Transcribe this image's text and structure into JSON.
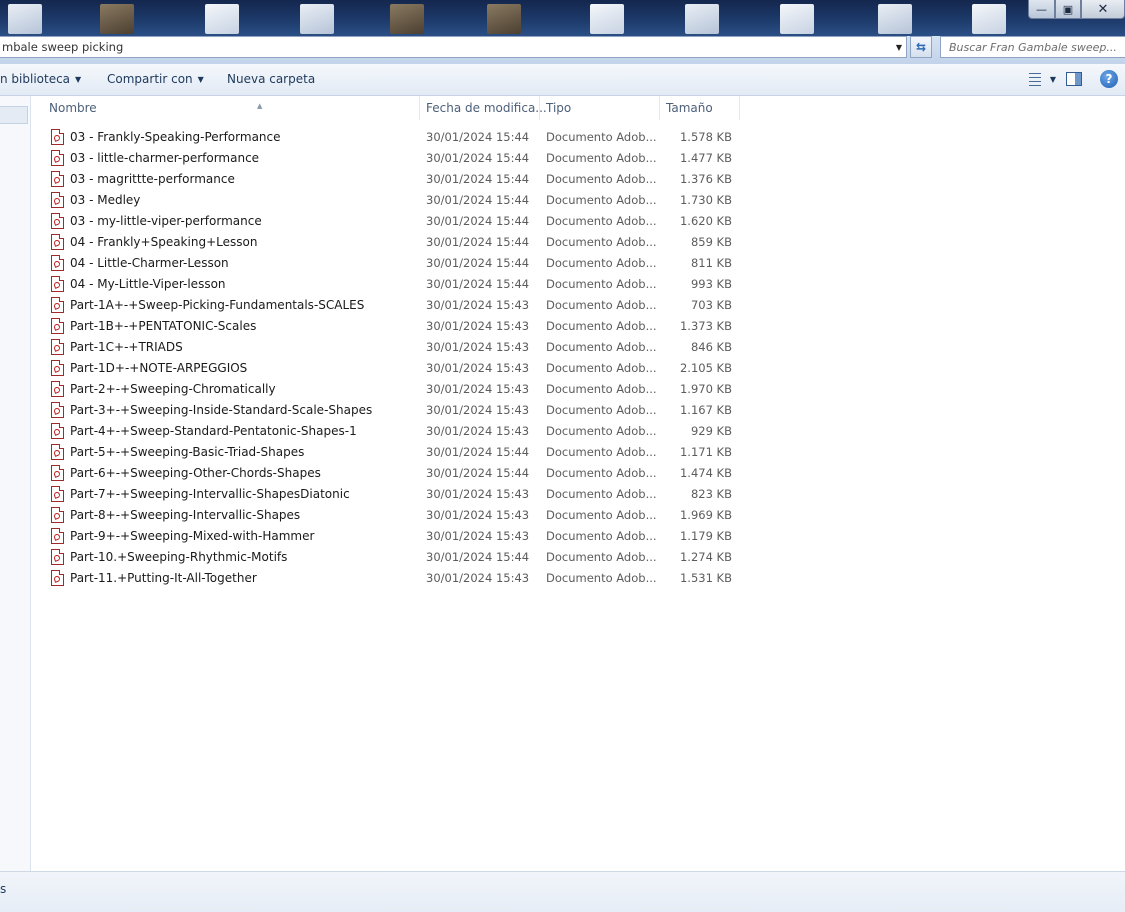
{
  "window": {
    "minimize_glyph": "—",
    "maximize_glyph": "▣",
    "close_glyph": "✕"
  },
  "address": {
    "path_text": "mbale sweep picking",
    "search_placeholder": "Buscar Fran Gambale sweep..."
  },
  "toolbar": {
    "include_library": "n biblioteca",
    "share_with": "Compartir con",
    "new_folder": "Nueva carpeta"
  },
  "columns": {
    "name": "Nombre",
    "date": "Fecha de modifica...",
    "type": "Tipo",
    "size": "Tamaño"
  },
  "files": [
    {
      "name": "03 - Frankly-Speaking-Performance",
      "date": "30/01/2024 15:44",
      "type": "Documento Adob...",
      "size": "1.578 KB"
    },
    {
      "name": "03 - little-charmer-performance",
      "date": "30/01/2024 15:44",
      "type": "Documento Adob...",
      "size": "1.477 KB"
    },
    {
      "name": "03 - magrittte-performance",
      "date": "30/01/2024 15:44",
      "type": "Documento Adob...",
      "size": "1.376 KB"
    },
    {
      "name": "03 - Medley",
      "date": "30/01/2024 15:44",
      "type": "Documento Adob...",
      "size": "1.730 KB"
    },
    {
      "name": "03 - my-little-viper-performance",
      "date": "30/01/2024 15:44",
      "type": "Documento Adob...",
      "size": "1.620 KB"
    },
    {
      "name": "04 - Frankly+Speaking+Lesson",
      "date": "30/01/2024 15:44",
      "type": "Documento Adob...",
      "size": "859 KB"
    },
    {
      "name": "04 - Little-Charmer-Lesson",
      "date": "30/01/2024 15:44",
      "type": "Documento Adob...",
      "size": "811 KB"
    },
    {
      "name": "04 - My-Little-Viper-lesson",
      "date": "30/01/2024 15:44",
      "type": "Documento Adob...",
      "size": "993 KB"
    },
    {
      "name": "Part-1A+-+Sweep-Picking-Fundamentals-SCALES",
      "date": "30/01/2024 15:43",
      "type": "Documento Adob...",
      "size": "703 KB"
    },
    {
      "name": "Part-1B+-+PENTATONIC-Scales",
      "date": "30/01/2024 15:43",
      "type": "Documento Adob...",
      "size": "1.373 KB"
    },
    {
      "name": "Part-1C+-+TRIADS",
      "date": "30/01/2024 15:43",
      "type": "Documento Adob...",
      "size": "846 KB"
    },
    {
      "name": "Part-1D+-+NOTE-ARPEGGIOS",
      "date": "30/01/2024 15:43",
      "type": "Documento Adob...",
      "size": "2.105 KB"
    },
    {
      "name": "Part-2+-+Sweeping-Chromatically",
      "date": "30/01/2024 15:43",
      "type": "Documento Adob...",
      "size": "1.970 KB"
    },
    {
      "name": "Part-3+-+Sweeping-Inside-Standard-Scale-Shapes",
      "date": "30/01/2024 15:43",
      "type": "Documento Adob...",
      "size": "1.167 KB"
    },
    {
      "name": "Part-4+-+Sweep-Standard-Pentatonic-Shapes-1",
      "date": "30/01/2024 15:43",
      "type": "Documento Adob...",
      "size": "929 KB"
    },
    {
      "name": "Part-5+-+Sweeping-Basic-Triad-Shapes",
      "date": "30/01/2024 15:44",
      "type": "Documento Adob...",
      "size": "1.171 KB"
    },
    {
      "name": "Part-6+-+Sweeping-Other-Chords-Shapes",
      "date": "30/01/2024 15:44",
      "type": "Documento Adob...",
      "size": "1.474 KB"
    },
    {
      "name": "Part-7+-+Sweeping-Intervallic-ShapesDiatonic",
      "date": "30/01/2024 15:43",
      "type": "Documento Adob...",
      "size": "823 KB"
    },
    {
      "name": "Part-8+-+Sweeping-Intervallic-Shapes",
      "date": "30/01/2024 15:43",
      "type": "Documento Adob...",
      "size": "1.969 KB"
    },
    {
      "name": "Part-9+-+Sweeping-Mixed-with-Hammer",
      "date": "30/01/2024 15:43",
      "type": "Documento Adob...",
      "size": "1.179 KB"
    },
    {
      "name": "Part-10.+Sweeping-Rhythmic-Motifs",
      "date": "30/01/2024 15:44",
      "type": "Documento Adob...",
      "size": "1.274 KB"
    },
    {
      "name": "Part-11.+Putting-It-All-Together",
      "date": "30/01/2024 15:43",
      "type": "Documento Adob...",
      "size": "1.531 KB"
    }
  ],
  "status": {
    "text": "s"
  },
  "icons": {
    "file": "pdf-icon",
    "refresh": "refresh-icon",
    "views": "views-icon",
    "preview": "preview-pane-icon",
    "help": "help-icon"
  }
}
